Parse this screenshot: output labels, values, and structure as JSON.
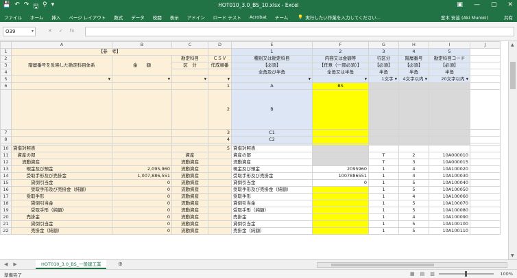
{
  "titlebar": {
    "title": "HOT010_3.0_BS_10.xlsx - Excel",
    "qat": [
      "💾",
      "↶",
      "↷",
      "🖫",
      "⚲",
      "▾"
    ],
    "winbtns": [
      "▣",
      "—",
      "▢",
      "✕"
    ]
  },
  "tabs": {
    "items": [
      "ファイル",
      "ホーム",
      "挿入",
      "ページ レイアウト",
      "数式",
      "データ",
      "校閲",
      "表示",
      "アドイン",
      "ロード テスト",
      "Acrobat",
      "チーム"
    ],
    "tellme": "実行したい作業を入力してください...",
    "user": "室木 安芸 (Aki Muroki)",
    "share": "共有"
  },
  "formulabar": {
    "namebox": "O39",
    "fx_cancel": "✕",
    "fx_enter": "✓",
    "fx_label": "fx",
    "value": ""
  },
  "grid": {
    "col_headers": [
      "A",
      "B",
      "C",
      "D",
      "E",
      "F",
      "G",
      "H",
      "I",
      "J"
    ],
    "header_block": {
      "ref_label": "【参　考】",
      "a_label": "階層番号を反映した勘定科目体系",
      "b_label": "金　　額",
      "c_label1": "勘定科目",
      "c_label2": "区　分",
      "d_label1": "ＣＳＶ",
      "d_label2": "作成順番",
      "e_num": "1",
      "e_l1": "種別又は勘定科目",
      "e_l2": "【必須】",
      "e_l3": "全角及び半角",
      "f_num": "2",
      "f_l1": "内容又は金額等",
      "f_l2": "【任意（一部必須）】",
      "f_l3": "全角又は半角",
      "g_num": "3",
      "g_l1": "行区分",
      "g_l2": "【必須】",
      "g_l3": "半角",
      "g_l4": "1文字",
      "h_num": "4",
      "h_l1": "階層番号",
      "h_l2": "【必須】",
      "h_l3": "半角",
      "h_l4": "4文字以内",
      "i_num": "5",
      "i_l1": "勘定科目コード",
      "i_l2": "【必須】",
      "i_l3": "半角",
      "i_l4": "20文字以内"
    },
    "meta_rows": [
      {
        "row": "6",
        "d": "1",
        "e": "A",
        "f": "BS"
      },
      {
        "row": "",
        "d": "2",
        "e": "B",
        "f": ""
      },
      {
        "row": "7",
        "d": "3",
        "e": "C1",
        "f": ""
      },
      {
        "row": "8",
        "d": "4",
        "e": "C2",
        "f": ""
      }
    ],
    "data_rows": [
      {
        "row": "10",
        "a": "貸借対照表",
        "b": "",
        "c": "",
        "d": "5",
        "e": "貸借対照表",
        "f": "",
        "fcls": "gray",
        "g": "",
        "h": "",
        "i": ""
      },
      {
        "row": "11",
        "a": "　資産の部",
        "b": "",
        "c": "資産",
        "d": "",
        "e": "資産の部",
        "f": "",
        "fcls": "gray",
        "g": "T",
        "h": "2",
        "i": "10A000010"
      },
      {
        "row": "12",
        "a": "　　流動資産",
        "b": "",
        "c": "流動資産",
        "d": "",
        "e": "流動資産",
        "f": "",
        "fcls": "gray",
        "g": "T",
        "h": "3",
        "i": "10A000015"
      },
      {
        "row": "13",
        "a": "　　　現金及び預金",
        "b": "2,095,960",
        "c": "流動資産",
        "d": "",
        "e": "現金及び預金",
        "f": "2095960",
        "fcls": "",
        "g": "1",
        "h": "4",
        "i": "10A100020"
      },
      {
        "row": "14",
        "a": "　　　受取手形及び売掛金",
        "b": "1,007,886,551",
        "c": "流動資産",
        "d": "",
        "e": "受取手形及び売掛金",
        "f": "1007886551",
        "fcls": "",
        "g": "1",
        "h": "4",
        "i": "10A100030"
      },
      {
        "row": "15",
        "a": "　　　　貸倒引当金",
        "b": "0",
        "c": "流動資産",
        "d": "",
        "e": "貸倒引当金",
        "f": "0",
        "fcls": "",
        "g": "1",
        "h": "5",
        "i": "10A100040"
      },
      {
        "row": "16",
        "a": "　　　　受取手形及び売掛金（純額）",
        "b": "0",
        "c": "流動資産",
        "d": "",
        "e": "受取手形及び売掛金（純額）",
        "f": "",
        "fcls": "yellow",
        "g": "1",
        "h": "5",
        "i": "10A100050"
      },
      {
        "row": "17",
        "a": "　　　受取手形",
        "b": "0",
        "c": "流動資産",
        "d": "",
        "e": "受取手形",
        "f": "",
        "fcls": "yellow",
        "g": "1",
        "h": "4",
        "i": "10A100060"
      },
      {
        "row": "18",
        "a": "　　　　貸倒引当金",
        "b": "0",
        "c": "流動資産",
        "d": "",
        "e": "貸倒引当金",
        "f": "",
        "fcls": "yellow",
        "g": "1",
        "h": "5",
        "i": "10A100070"
      },
      {
        "row": "19",
        "a": "　　　　受取手形（純額）",
        "b": "0",
        "c": "流動資産",
        "d": "",
        "e": "受取手形（純額）",
        "f": "",
        "fcls": "yellow",
        "g": "1",
        "h": "5",
        "i": "10A100080"
      },
      {
        "row": "20",
        "a": "　　　売掛金",
        "b": "0",
        "c": "流動資産",
        "d": "",
        "e": "売掛金",
        "f": "",
        "fcls": "yellow",
        "g": "1",
        "h": "4",
        "i": "10A100090"
      },
      {
        "row": "21",
        "a": "　　　　貸倒引当金",
        "b": "0",
        "c": "流動資産",
        "d": "",
        "e": "貸倒引当金",
        "f": "",
        "fcls": "yellow",
        "g": "1",
        "h": "5",
        "i": "10A100100"
      },
      {
        "row": "22",
        "a": "　　　　売掛金（純額）",
        "b": "0",
        "c": "流動資産",
        "d": "",
        "e": "売掛金（純額）",
        "f": "",
        "fcls": "yellow",
        "g": "1",
        "h": "5",
        "i": "10A100110"
      }
    ]
  },
  "sheetbar": {
    "nav_prev": "◀",
    "nav_next": "▶",
    "tab_label": "HOT010_3.0_BS_一般建工業",
    "add": "⊕"
  },
  "statusbar": {
    "ready": "準備完了",
    "zoom": "100%"
  }
}
